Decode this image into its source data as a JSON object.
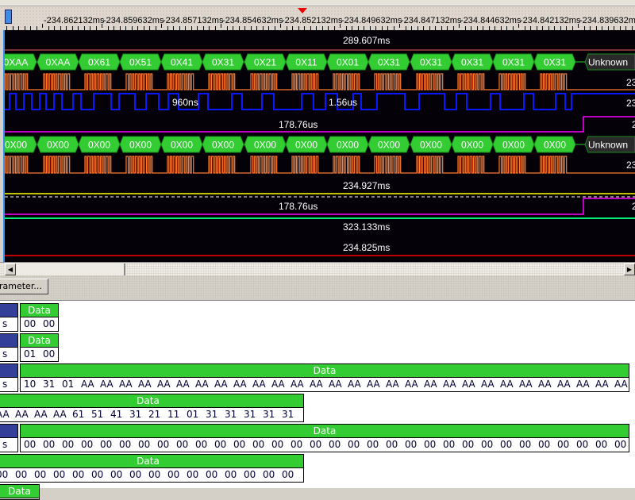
{
  "ruler": {
    "ticks": [
      "-234.862132ms",
      "-234.859632ms",
      "-234.857132ms",
      "-234.854632ms",
      "-234.852132ms",
      "-234.849632ms",
      "-234.847132ms",
      "-234.844632ms",
      "-234.842132ms",
      "-234.839632ms"
    ],
    "cursor_color": "#e00000"
  },
  "waveform": {
    "labels": {
      "period1": "289.607ms",
      "pulse_a": "960ns",
      "pulse_b": "1.56us",
      "width1": "178.76us",
      "period2": "234.927ms",
      "width2": "178.76us",
      "period3": "323.133ms",
      "period4": "234.825ms",
      "right1": "23",
      "right2": "23",
      "right3": "2",
      "right4": "23",
      "right5": "2"
    },
    "decode_row1": [
      "0XAA",
      "0XAA",
      "0X61",
      "0X51",
      "0X41",
      "0X31",
      "0X21",
      "0X11",
      "0X01",
      "0X31",
      "0X31",
      "0X31",
      "0X31",
      "0X31"
    ],
    "decode_row2": [
      "0X00",
      "0X00",
      "0X00",
      "0X00",
      "0X00",
      "0X00",
      "0X00",
      "0X00",
      "0X00",
      "0X00",
      "0X00",
      "0X00",
      "0X00",
      "0X00"
    ],
    "unknown_label": "Unknown",
    "colors": {
      "clock": "#ff7a30",
      "data": "#0a18ff",
      "enable": "#ff00ff",
      "decode": "#33cc33",
      "ref1": "#a04040",
      "ref2": "#ffff00",
      "ref3": "#00ee77",
      "ref4": "#ff0000"
    }
  },
  "toolbar": {
    "parameter_button": "rameter..."
  },
  "packets": {
    "header_label": "Data",
    "side_label": "s",
    "rows": [
      [
        "00",
        "00"
      ],
      [
        "01",
        "00"
      ],
      [
        "10",
        "31",
        "01",
        "AA",
        "AA",
        "AA",
        "AA",
        "AA",
        "AA",
        "AA",
        "AA",
        "AA",
        "AA",
        "AA",
        "AA",
        "AA",
        "AA",
        "AA",
        "AA",
        "AA",
        "AA",
        "AA",
        "AA",
        "AA",
        "AA",
        "AA",
        "AA",
        "AA",
        "AA",
        "AA",
        "AA",
        "AA"
      ],
      [
        "AA",
        "AA",
        "AA",
        "AA",
        "61",
        "51",
        "41",
        "31",
        "21",
        "11",
        "01",
        "31",
        "31",
        "31",
        "31",
        "31"
      ],
      [
        "00",
        "00",
        "00",
        "00",
        "00",
        "00",
        "00",
        "00",
        "00",
        "00",
        "00",
        "00",
        "00",
        "00",
        "00",
        "00",
        "00",
        "00",
        "00",
        "00",
        "00",
        "00",
        "00",
        "00",
        "00",
        "00",
        "00",
        "00",
        "00",
        "00",
        "00",
        "00"
      ],
      [
        "00",
        "00",
        "00",
        "00",
        "00",
        "00",
        "00",
        "00",
        "00",
        "00",
        "00",
        "00",
        "00",
        "00",
        "00",
        "00"
      ]
    ]
  }
}
